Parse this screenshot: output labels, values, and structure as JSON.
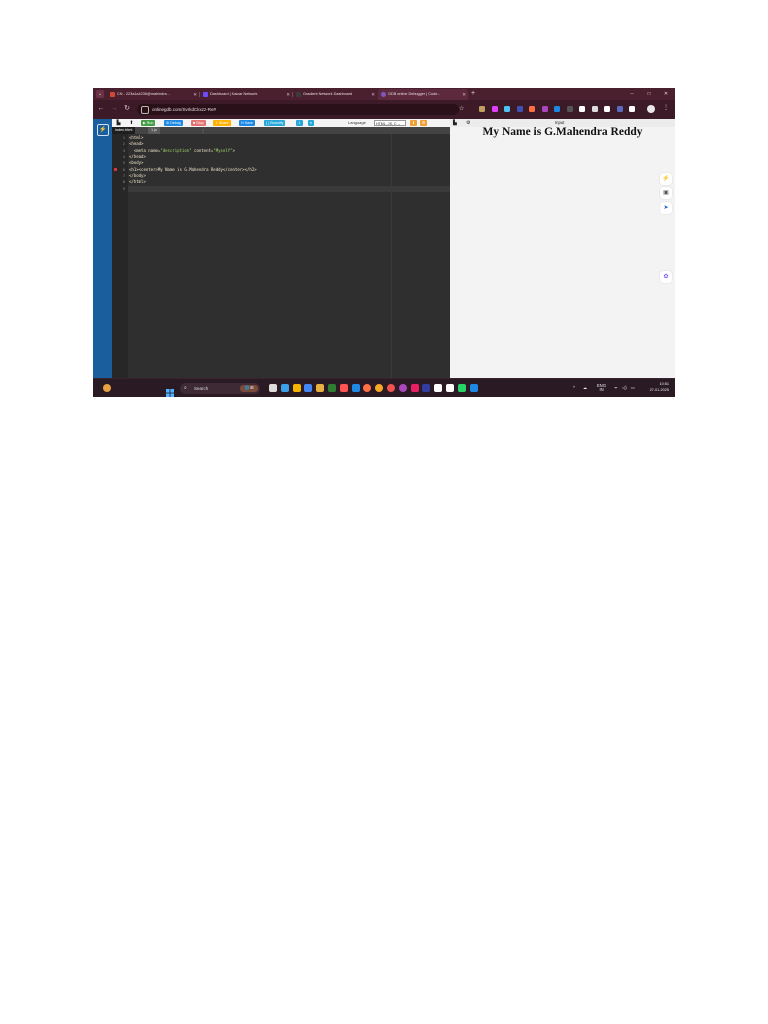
{
  "browser": {
    "tabs": [
      {
        "title": "CN - 223a1a4236@mahindra...",
        "favicon_color": "#d14836",
        "active": false
      },
      {
        "title": "Dashboard | Kaizar Network",
        "favicon_color": "#6d4cff",
        "active": false
      },
      {
        "title": "Gradient Network Dashboard",
        "favicon_color": "#3b3b3b",
        "active": false
      },
      {
        "title": "GDB online Debugger | Code...",
        "favicon_color": "#7e57c2",
        "active": true
      }
    ],
    "tab_close": "✕",
    "new_tab": "+",
    "window_controls": {
      "minimize": "–",
      "maximize": "□",
      "close": "✕"
    },
    "url": "onlinegdb.com/SvrkdCkxzz-Re#",
    "extension_colors": [
      "#c0a060",
      "#e040fb",
      "#4fc3f7",
      "#3f51b5",
      "#ff7043",
      "#ab47bc",
      "#1e88e5",
      "#555555",
      "#ffffff",
      "#dddddd",
      "#ffffff",
      "#5c6bc0",
      "#ffffff"
    ]
  },
  "toolbar": {
    "run": "▶ Run",
    "debug": "⚙ Debug",
    "stop": "■ Stop",
    "share": "⇪ Share",
    "save": "H Save",
    "beautify": "{ } Beautify",
    "download": "⇩",
    "more": "▾",
    "language_label": "Language",
    "language_value": "HTML, JS, C ⌄"
  },
  "file_tabs": {
    "active": "index.html",
    "other": "1.js",
    "more": "⋮"
  },
  "code_lines": [
    {
      "n": "1",
      "html": "&lt;html&gt;"
    },
    {
      "n": "2",
      "html": "&lt;head&gt;"
    },
    {
      "n": "3",
      "html": "  &lt;meta name=<span class='str'>\"description\"</span> content=<span class='str'>\"Myself\"</span>&gt;"
    },
    {
      "n": "4",
      "html": "&lt;/head&gt;"
    },
    {
      "n": "5",
      "html": "&lt;body&gt;"
    },
    {
      "n": "6",
      "html": "&lt;h1&gt;&lt;center&gt;My Name is G.Mahendra Reddy&lt;/center&gt;&lt;/h2&gt;",
      "error": true
    },
    {
      "n": "7",
      "html": "&lt;/body&gt;"
    },
    {
      "n": "8",
      "html": "&lt;/html&gt;"
    },
    {
      "n": "9",
      "html": ""
    }
  ],
  "output": {
    "input_label": "Input",
    "heading": "My Name is G.Mahendra Reddy"
  },
  "taskbar": {
    "search_placeholder": "Search",
    "search_badge": "🌐 ⊞",
    "lang_top": "ENG",
    "lang_bottom": "IN",
    "time": "10:51",
    "date": "27-01-2025"
  }
}
